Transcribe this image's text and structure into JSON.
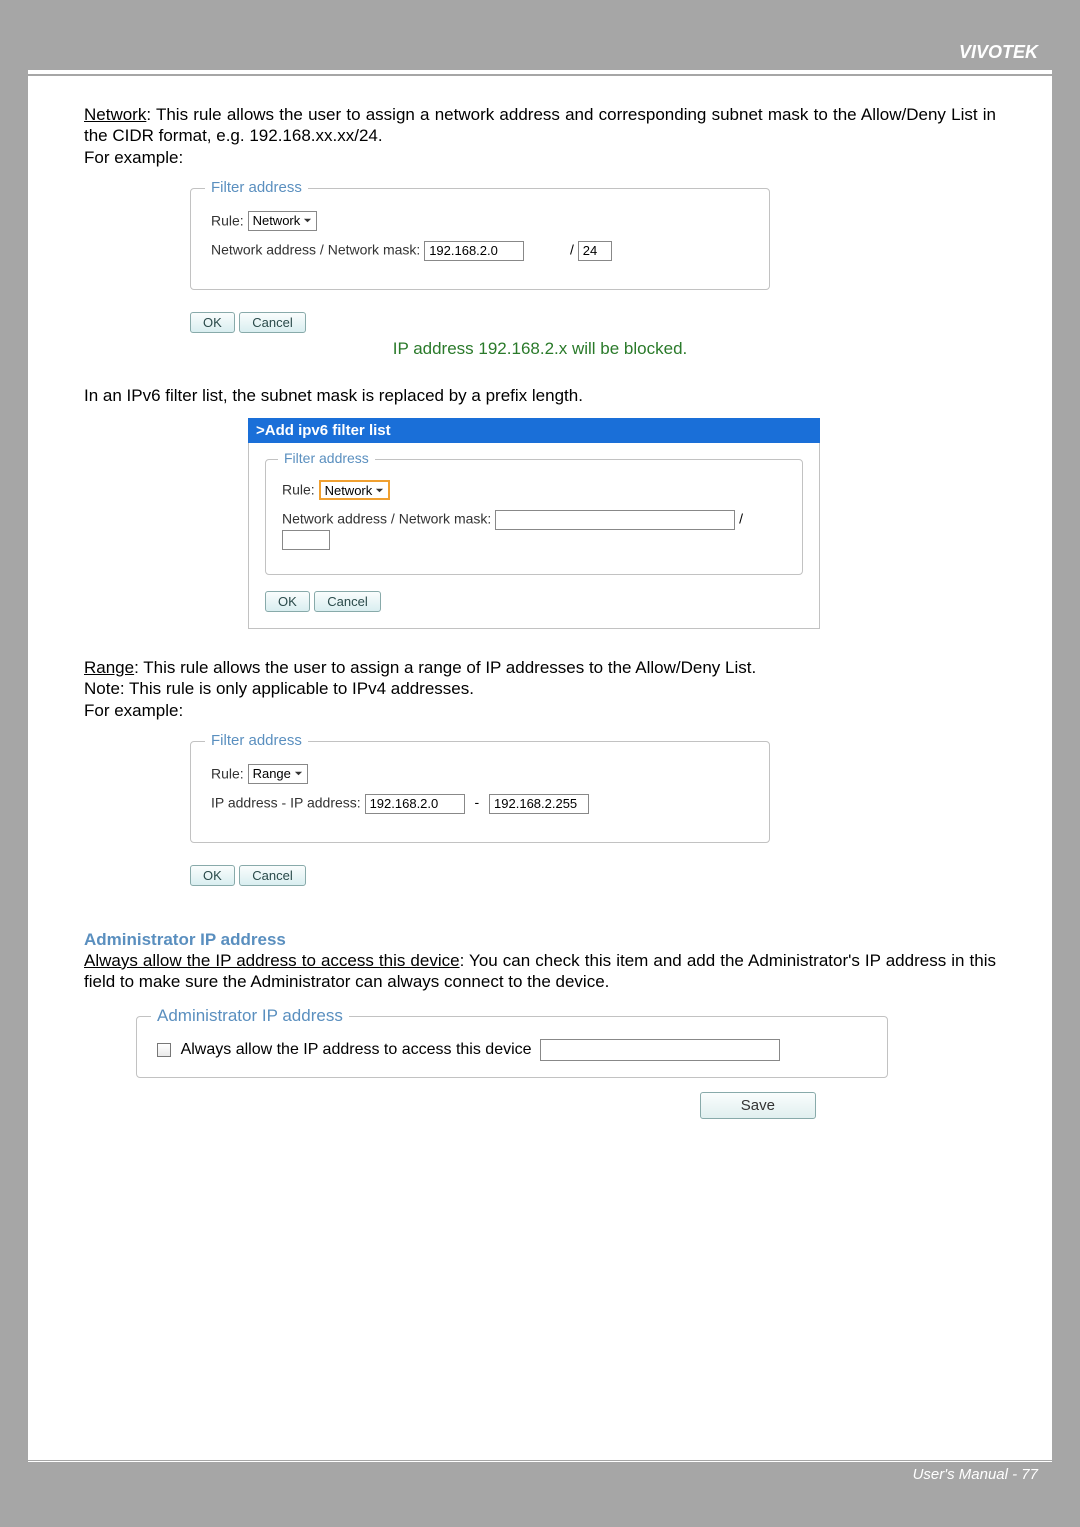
{
  "header": {
    "brand": "VIVOTEK"
  },
  "network_section": {
    "label": "Network",
    "desc": ": This rule allows the user to assign a network address and corresponding subnet mask to the Allow/Deny List in the CIDR format, e.g. 192.168.xx.xx/24.",
    "example": "For example:"
  },
  "filter1": {
    "legend": "Filter address",
    "rule_label": "Rule:",
    "rule_value": "Network",
    "addr_label": "Network address / Network mask:",
    "addr_value": "192.168.2.0",
    "slash": "/",
    "mask_value": "24",
    "ok": "OK",
    "cancel": "Cancel"
  },
  "caption1": "IP address 192.168.2.x will be blocked.",
  "ipv6_intro": "In an IPv6 filter list, the subnet mask is replaced by a prefix length.",
  "ipv6box": {
    "title": ">Add ipv6 filter list",
    "legend": "Filter address",
    "rule_label": "Rule:",
    "rule_value": "Network",
    "addr_label": "Network address / Network mask:",
    "slash": "/",
    "ok": "OK",
    "cancel": "Cancel"
  },
  "range_section": {
    "label": "Range",
    "desc": ": This rule allows the user to assign a range of IP addresses to the Allow/Deny List.",
    "note": "Note: This rule is only applicable to IPv4 addresses.",
    "example": "For example:"
  },
  "filter2": {
    "legend": "Filter address",
    "rule_label": "Rule:",
    "rule_value": "Range",
    "addr_label": "IP address - IP address:",
    "start_value": "192.168.2.0",
    "dash": "-",
    "end_value": "192.168.2.255",
    "ok": "OK",
    "cancel": "Cancel"
  },
  "admin": {
    "heading": "Administrator IP address",
    "label": "Always allow the IP address to access this device",
    "desc": ": You can check this item and add the Administrator's IP address in this field to make sure the Administrator can always connect to the device.",
    "box_legend": "Administrator IP address",
    "checkbox_label": "Always allow the IP address to access this device",
    "save": "Save"
  },
  "footer": {
    "text": "User's Manual - 77"
  }
}
